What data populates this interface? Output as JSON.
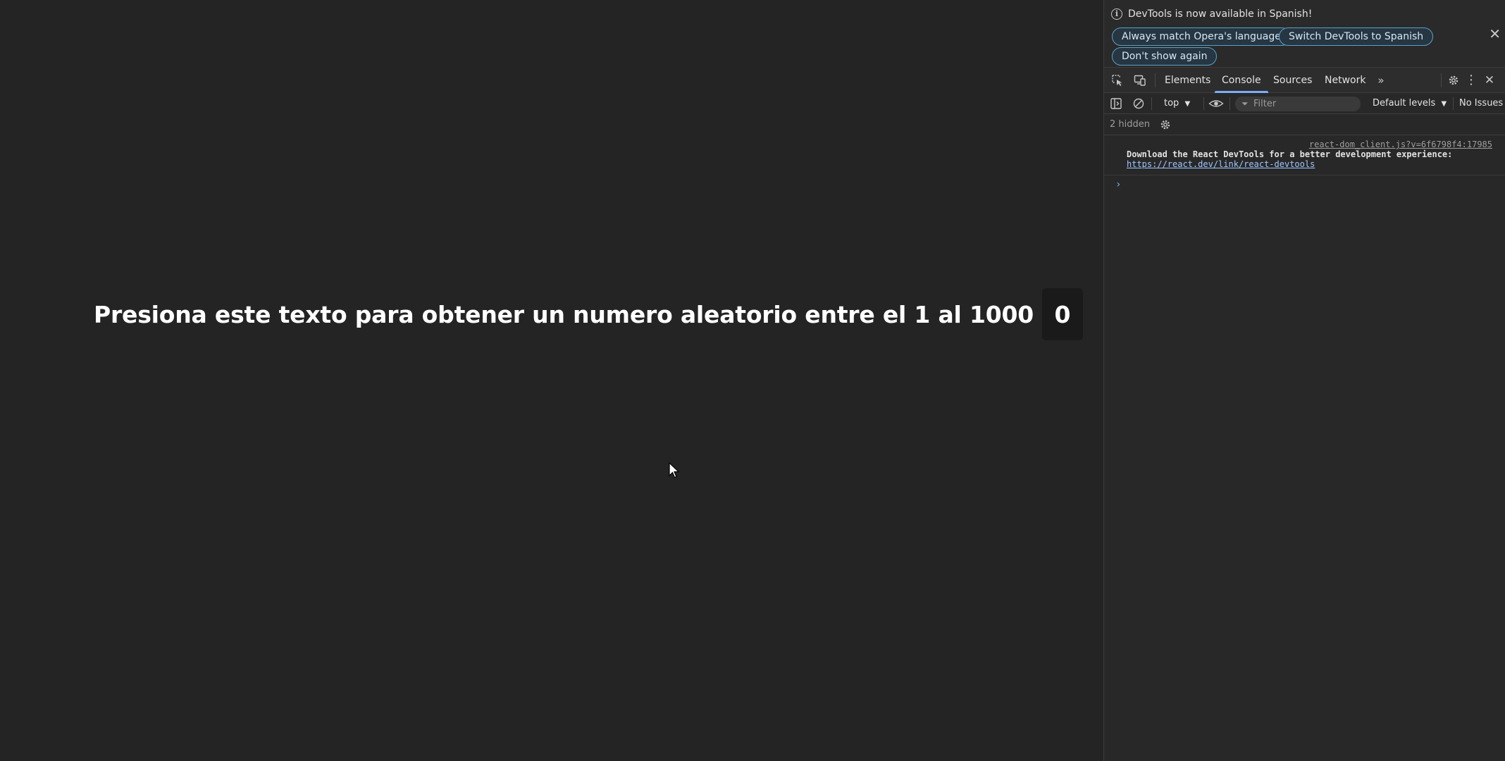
{
  "page": {
    "prompt_text": "Presiona este texto para obtener un numero aleatorio entre el 1 al 1000",
    "random_number": "0"
  },
  "devtools": {
    "infobar": {
      "message": "DevTools is now available in Spanish!",
      "buttons": {
        "match_language": "Always match Opera's language",
        "switch_spanish": "Switch DevTools to Spanish",
        "dont_show": "Don't show again"
      }
    },
    "tabs": {
      "elements": "Elements",
      "console": "Console",
      "sources": "Sources",
      "network": "Network"
    },
    "console_toolbar": {
      "context": "top",
      "filter_placeholder": "Filter",
      "levels": "Default levels",
      "issues": "No Issues"
    },
    "hidden_count": "2 hidden",
    "messages": [
      {
        "source": "react-dom_client.js?v=6f6798f4:17985",
        "text": "Download the React DevTools for a better development experience:",
        "link": "https://react.dev/link/react-devtools"
      }
    ],
    "colors": {
      "accent": "#7cacf8",
      "pill_border": "#5ba1c5"
    }
  }
}
